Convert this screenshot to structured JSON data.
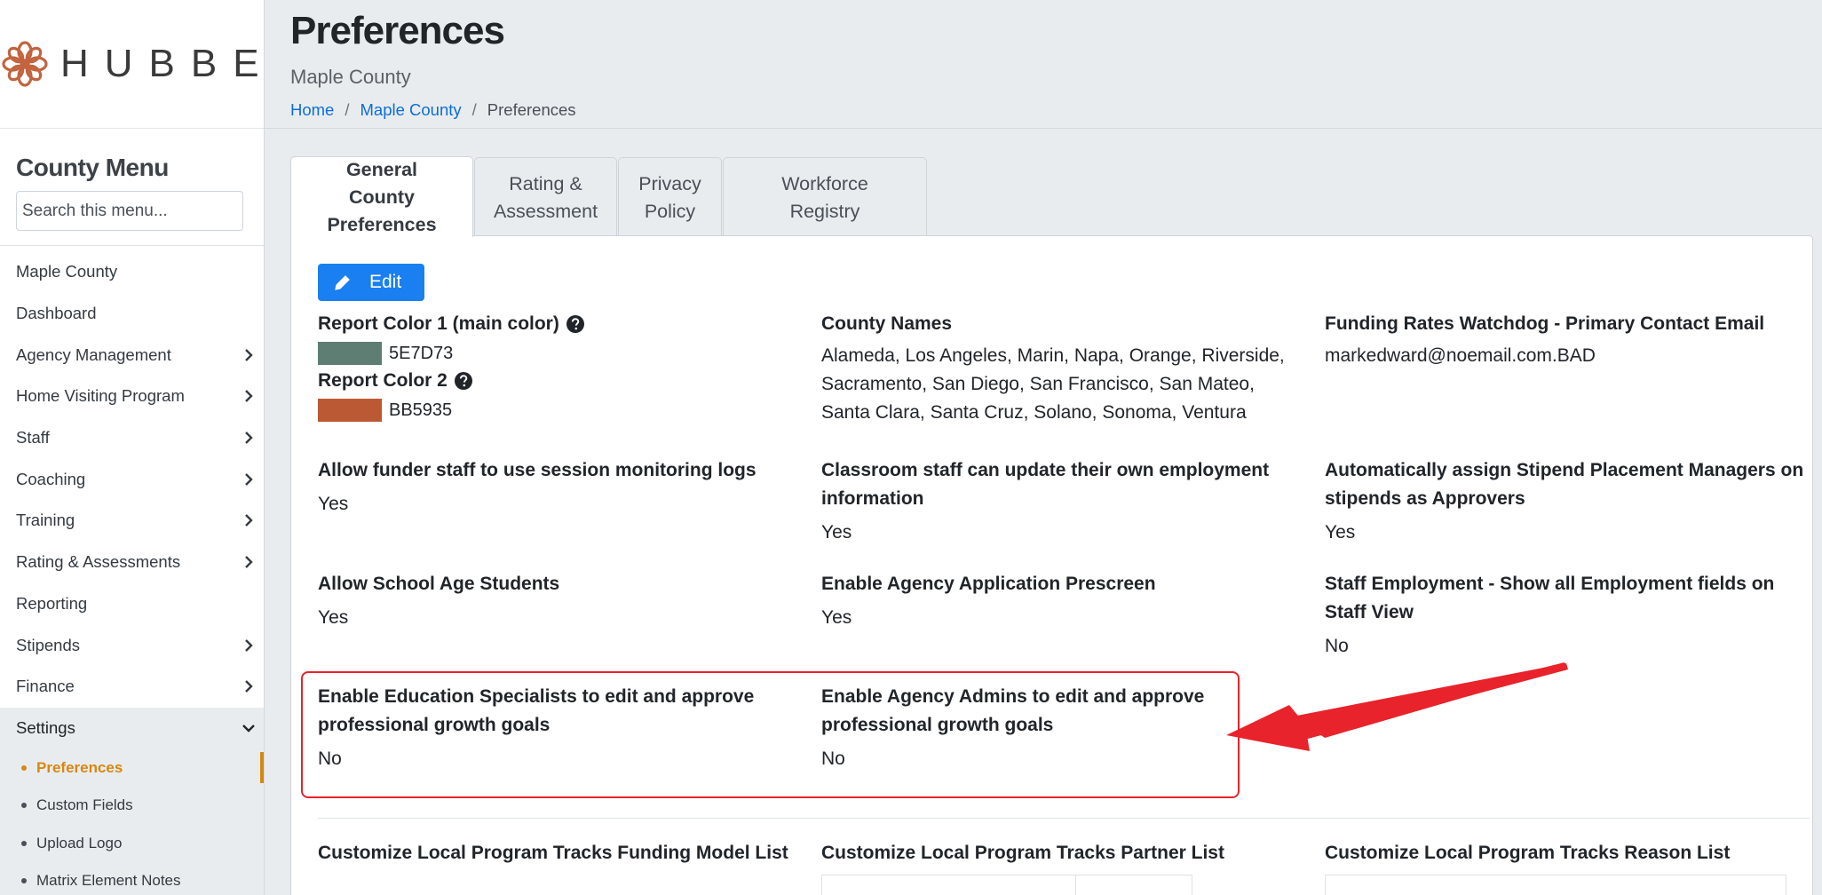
{
  "brand": {
    "logo_text": "HUBBE",
    "logo_color": "#c2643f"
  },
  "sidebar": {
    "title": "County Menu",
    "search_placeholder": "Search this menu...",
    "items": [
      {
        "label": "Maple County",
        "has_children": false
      },
      {
        "label": "Dashboard",
        "has_children": false
      },
      {
        "label": "Agency Management",
        "has_children": true
      },
      {
        "label": "Home Visiting Program",
        "has_children": true
      },
      {
        "label": "Staff",
        "has_children": true
      },
      {
        "label": "Coaching",
        "has_children": true
      },
      {
        "label": "Training",
        "has_children": true
      },
      {
        "label": "Rating & Assessments",
        "has_children": true
      },
      {
        "label": "Reporting",
        "has_children": false
      },
      {
        "label": "Stipends",
        "has_children": true
      },
      {
        "label": "Finance",
        "has_children": true
      },
      {
        "label": "Settings",
        "has_children": true,
        "expanded": true
      }
    ],
    "settings_children": [
      {
        "label": "Preferences",
        "current": true
      },
      {
        "label": "Custom Fields"
      },
      {
        "label": "Upload Logo"
      },
      {
        "label": "Matrix Element Notes"
      }
    ],
    "accent_color": "#d8870f"
  },
  "header": {
    "title": "Preferences",
    "subtitle": "Maple County",
    "breadcrumb": [
      {
        "label": "Home",
        "link": true
      },
      {
        "label": "Maple County",
        "link": true
      },
      {
        "label": "Preferences",
        "link": false
      }
    ]
  },
  "tabs": [
    {
      "label": "General County Preferences",
      "active": true
    },
    {
      "label": "Rating & Assessment"
    },
    {
      "label": "Privacy Policy"
    },
    {
      "label": "Workforce Registry"
    }
  ],
  "edit_button": {
    "label": "Edit",
    "color": "#1a7ff0"
  },
  "preferences": {
    "report_color_1": {
      "label": "Report Color 1 (main color)",
      "value": "5E7D73",
      "swatch": "#5e7d73"
    },
    "report_color_2": {
      "label": "Report Color 2",
      "value": "BB5935",
      "swatch": "#bb5935"
    },
    "county_names": {
      "label": "County Names",
      "value": "Alameda, Los Angeles, Marin, Napa, Orange, Riverside, Sacramento, San Diego, San Francisco, San Mateo, Santa Clara, Santa Cruz, Solano, Sonoma, Ventura"
    },
    "watchdog_email": {
      "label": "Funding Rates Watchdog - Primary Contact Email",
      "value": "markedward@noemail.com.BAD"
    },
    "session_logs": {
      "label": "Allow funder staff to use session monitoring logs",
      "value": "Yes"
    },
    "classroom_staff": {
      "label": "Classroom staff can update their own employment information",
      "value": "Yes"
    },
    "stipend_managers": {
      "label": "Automatically assign Stipend Placement Managers on stipends as Approvers",
      "value": "Yes"
    },
    "school_age": {
      "label": "Allow School Age Students",
      "value": "Yes"
    },
    "prescreen": {
      "label": "Enable Agency Application Prescreen",
      "value": "Yes"
    },
    "employment_fields": {
      "label": "Staff Employment - Show all Employment fields on Staff View",
      "value": "No"
    },
    "edu_specialists": {
      "label": "Enable Education Specialists to edit and approve professional growth goals",
      "value": "No"
    },
    "agency_admins": {
      "label": "Enable Agency Admins to edit and approve professional growth goals",
      "value": "No"
    },
    "funding_model": {
      "label": "Customize Local Program Tracks Funding Model List"
    },
    "partner_list": {
      "label": "Customize Local Program Tracks Partner List"
    },
    "reason_list": {
      "label": "Customize Local Program Tracks Reason List"
    }
  },
  "annotation": {
    "highlight_color": "#e8232b"
  }
}
